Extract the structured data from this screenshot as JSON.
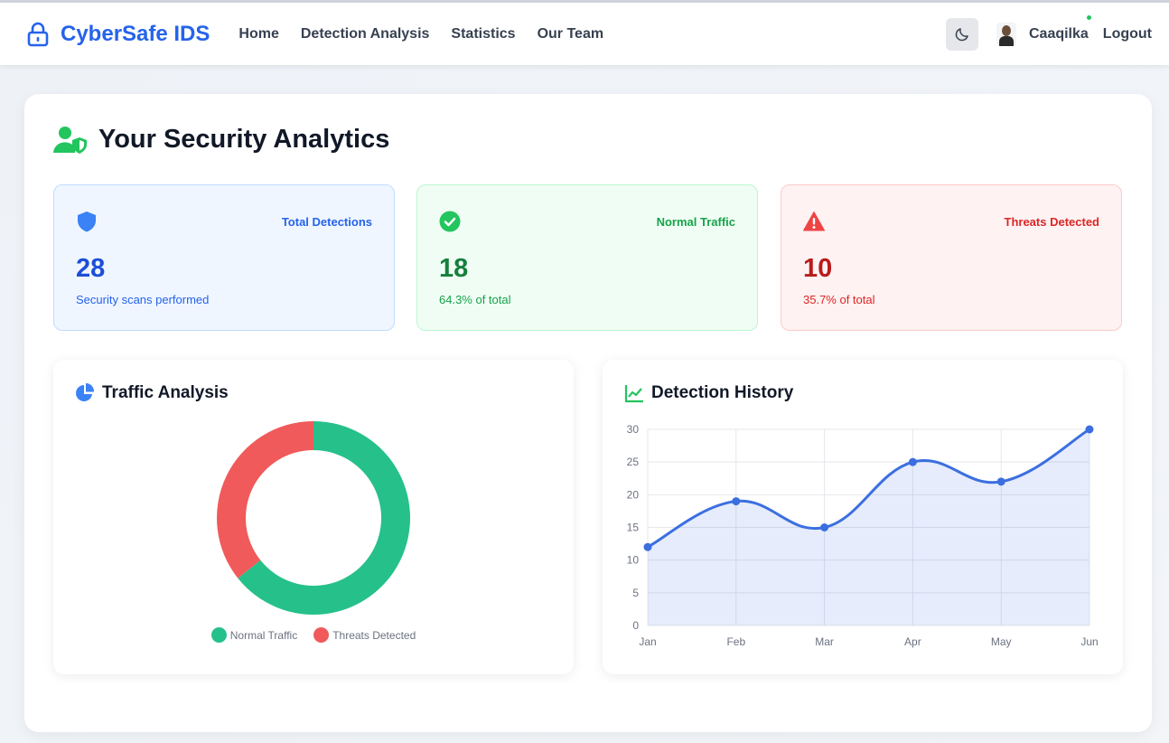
{
  "nav": {
    "brand": "CyberSafe IDS",
    "links": [
      "Home",
      "Detection Analysis",
      "Statistics",
      "Our Team"
    ],
    "username": "Caaqilka",
    "logout": "Logout",
    "theme_icon": "moon-icon",
    "brand_icon": "lock-icon"
  },
  "page": {
    "title": "Your Security Analytics",
    "title_icon": "user-shield-icon"
  },
  "stats": {
    "total": {
      "label": "Total Detections",
      "value": "28",
      "sub": "Security scans performed",
      "icon": "shield-icon",
      "color": "#2563eb"
    },
    "normal": {
      "label": "Normal Traffic",
      "value": "18",
      "sub": "64.3% of total",
      "icon": "check-circle-icon",
      "color": "#22c55e"
    },
    "threats": {
      "label": "Threats Detected",
      "value": "10",
      "sub": "35.7% of total",
      "icon": "warning-icon",
      "color": "#ef4444"
    }
  },
  "traffic": {
    "title": "Traffic Analysis",
    "icon": "pie-chart-icon",
    "legend": [
      "Normal Traffic",
      "Threats Detected"
    ]
  },
  "history": {
    "title": "Detection History",
    "icon": "line-chart-icon"
  },
  "chart_data": [
    {
      "type": "pie",
      "title": "Traffic Analysis",
      "categories": [
        "Normal Traffic",
        "Threats Detected"
      ],
      "values": [
        18,
        10
      ],
      "colors": [
        "#26c08b",
        "#f05a5a"
      ],
      "legend_position": "bottom"
    },
    {
      "type": "line",
      "title": "Detection History",
      "x": [
        "Jan",
        "Feb",
        "Mar",
        "Apr",
        "May",
        "Jun"
      ],
      "series": [
        {
          "values": [
            12,
            19,
            15,
            25,
            22,
            30
          ]
        }
      ],
      "ylim": [
        0,
        30
      ],
      "yticks": [
        0,
        5,
        10,
        15,
        20,
        25,
        30
      ],
      "grid": true,
      "color": "#3b6fe0",
      "fill": true
    }
  ]
}
